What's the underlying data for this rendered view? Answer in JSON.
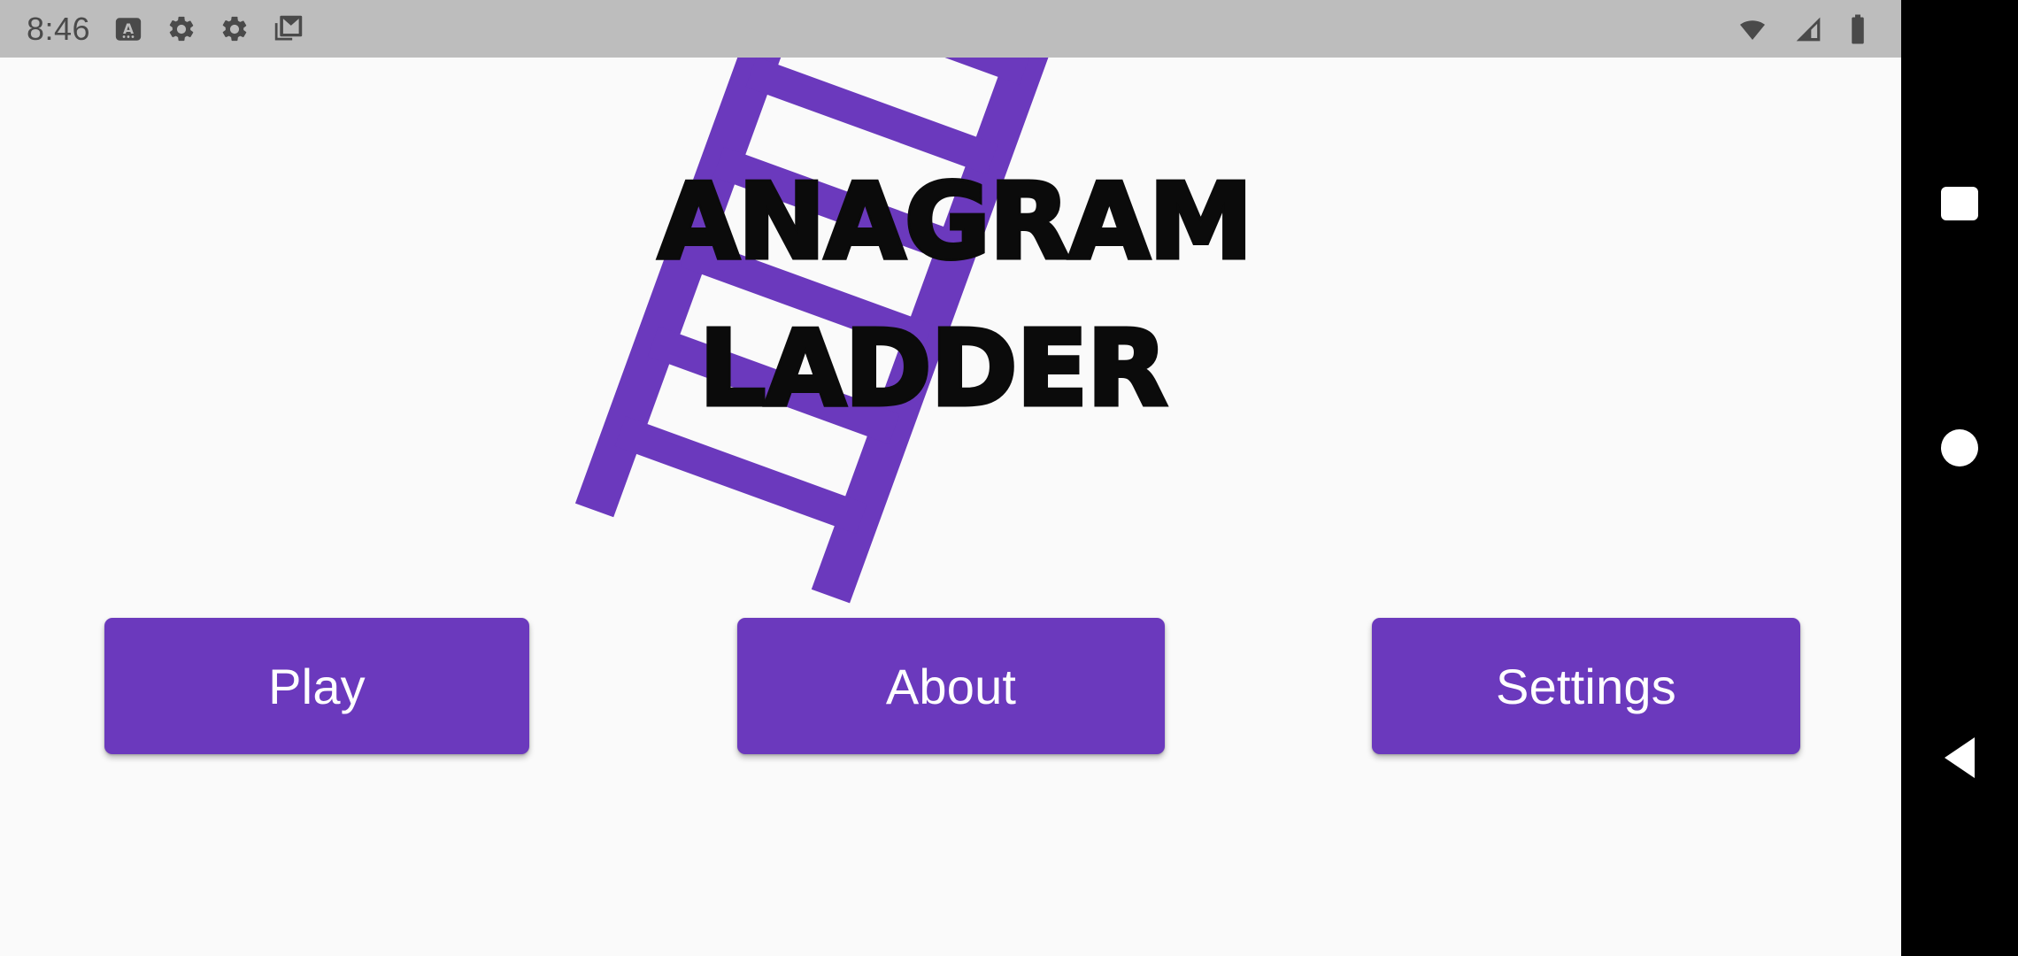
{
  "app": {
    "title_line_1": "ANAGRAM",
    "title_line_2": "LADDER",
    "background_color": "#FAFAFA",
    "accent_color": "#6B39BD"
  },
  "status_bar": {
    "background_color": "#BDBDBD",
    "clock": "8:46",
    "left_icons": [
      {
        "name": "keyboard-input-icon",
        "glyph": "A"
      },
      {
        "name": "settings-gear-icon",
        "glyph": "gear"
      },
      {
        "name": "settings-gear-icon-2",
        "glyph": "gear"
      },
      {
        "name": "gmail-icon",
        "glyph": "mail"
      }
    ],
    "right_icons": [
      {
        "name": "wifi-icon",
        "glyph": "wifi"
      },
      {
        "name": "cellular-signal-icon",
        "glyph": "signal"
      },
      {
        "name": "battery-icon",
        "glyph": "battery"
      }
    ]
  },
  "ladder": {
    "name": "ladder-illustration",
    "color": "#6B39BD",
    "rotation_degrees": 20,
    "rungs": 6
  },
  "menu": {
    "buttons": [
      {
        "name": "play-button",
        "label": "Play"
      },
      {
        "name": "about-button",
        "label": "About"
      },
      {
        "name": "settings-button",
        "label": "Settings"
      }
    ]
  },
  "nav_bar": {
    "background_color": "#000000",
    "buttons": [
      {
        "name": "recents-button",
        "glyph": "square"
      },
      {
        "name": "home-button",
        "glyph": "circle"
      },
      {
        "name": "back-button",
        "glyph": "triangle"
      }
    ]
  }
}
